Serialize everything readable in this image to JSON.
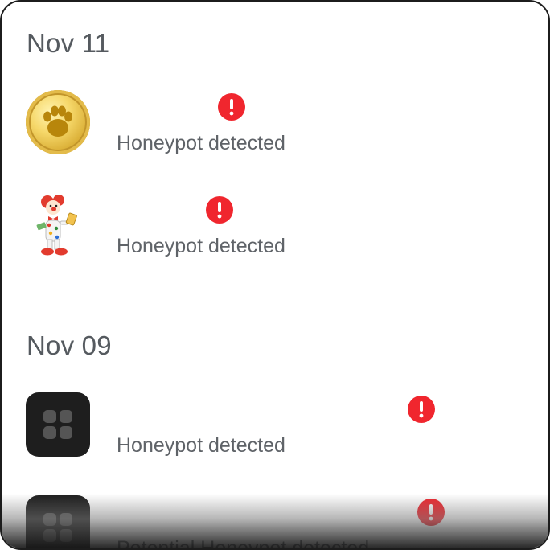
{
  "sections": [
    {
      "date": "Nov 11",
      "items": [
        {
          "icon": "paw-coin-icon",
          "status": "Honeypot detected",
          "alert_icon": "exclamation-alert-icon"
        },
        {
          "icon": "clown-token-icon",
          "status": "Honeypot detected",
          "alert_icon": "exclamation-alert-icon"
        }
      ]
    },
    {
      "date": "Nov 09",
      "items": [
        {
          "icon": "app-grid-icon",
          "status": "Honeypot detected",
          "alert_icon": "exclamation-alert-icon"
        },
        {
          "icon": "app-grid-icon",
          "status": "Potential Honeypot detected",
          "alert_icon": "exclamation-alert-icon"
        }
      ]
    }
  ],
  "colors": {
    "alert": "#f0262e",
    "text": "#5f6368",
    "header": "#555a5f"
  }
}
